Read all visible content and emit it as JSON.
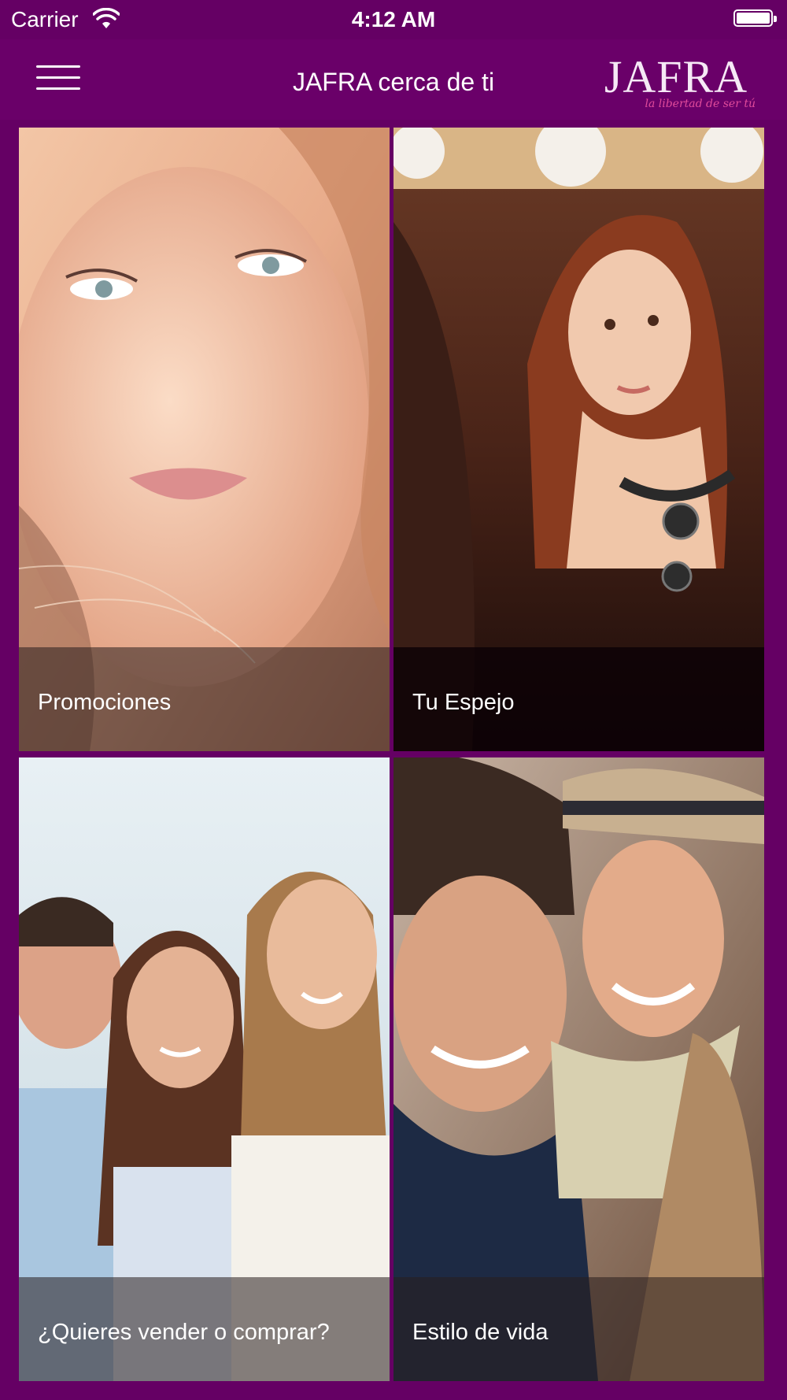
{
  "status_bar": {
    "carrier": "Carrier",
    "time": "4:12 AM"
  },
  "nav": {
    "title": "JAFRA cerca de ti"
  },
  "brand": {
    "name": "JAFRA",
    "tagline": "la libertad de ser tú"
  },
  "tiles": [
    {
      "label": "Promociones"
    },
    {
      "label": "Tu Espejo"
    },
    {
      "label": "¿Quieres vender o comprar?"
    },
    {
      "label": "Estilo de vida"
    }
  ],
  "colors": {
    "background": "#650064",
    "nav": "#6a0069",
    "accent": "#e14b9b"
  }
}
